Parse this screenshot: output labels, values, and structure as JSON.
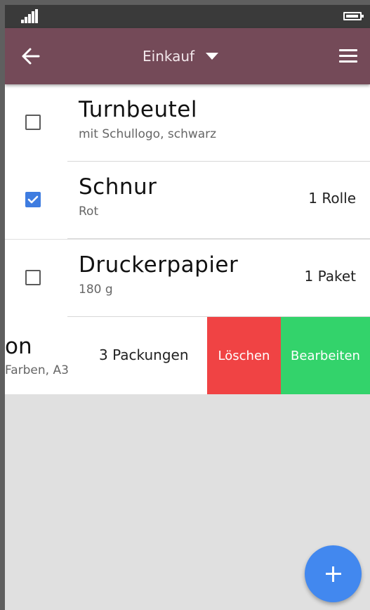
{
  "app_bar": {
    "title": "Einkauf",
    "back_icon": "arrow-left-icon",
    "dropdown_icon": "caret-down-icon",
    "menu_icon": "hamburger-menu-icon"
  },
  "status_bar": {
    "signal_icon": "signal-icon",
    "battery_icon": "battery-icon"
  },
  "items": [
    {
      "title": "Turnbeutel",
      "subtitle": "mit Schullogo, schwarz",
      "quantity": "",
      "checked": false
    },
    {
      "title": "Schnur",
      "subtitle": "Rot",
      "quantity": "1 Rolle",
      "checked": true
    },
    {
      "title": "Druckerpapier",
      "subtitle": "180 g",
      "quantity": "1 Paket",
      "checked": false
    }
  ],
  "swiped_item": {
    "title_partial": "on",
    "subtitle_partial": "Farben, A3",
    "quantity": "3 Packungen",
    "delete_label": "Löschen",
    "edit_label": "Bearbeiten"
  },
  "colors": {
    "app_bar": "#744a58",
    "checkbox_checked": "#3e7ce0",
    "delete": "#f04344",
    "edit": "#33d36b",
    "fab": "#4288ef"
  },
  "fab": {
    "icon": "plus-icon"
  }
}
